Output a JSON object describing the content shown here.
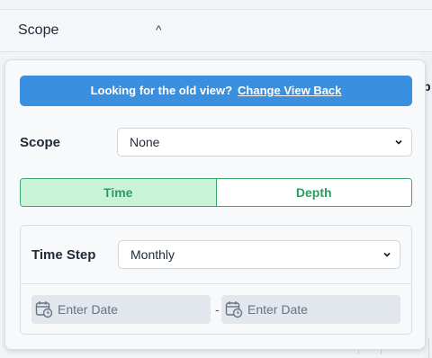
{
  "header": {
    "label": "Scope",
    "caret": "^"
  },
  "edge_fragment": "p",
  "banner": {
    "text": "Looking for the old view?",
    "link": "Change View Back"
  },
  "scope": {
    "label": "Scope",
    "value": "None"
  },
  "mode_toggle": {
    "time_label": "Time",
    "depth_label": "Depth",
    "active": "Time"
  },
  "time_step": {
    "label": "Time Step",
    "value": "Monthly"
  },
  "date_range": {
    "start_placeholder": "Enter Date",
    "separator": "-",
    "end_placeholder": "Enter Date"
  },
  "colors": {
    "banner": "#3b8fe0",
    "toggle_accent": "#3aa76d",
    "toggle_active_bg": "#c8f3d6"
  }
}
